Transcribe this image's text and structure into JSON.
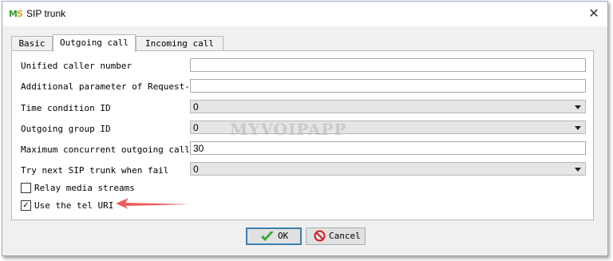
{
  "window": {
    "title": "SIP trunk",
    "close_glyph": "✕"
  },
  "tabs": [
    {
      "label": "Basic",
      "active": false
    },
    {
      "label": "Outgoing call",
      "active": true
    },
    {
      "label": "Incoming call",
      "active": false
    }
  ],
  "form": {
    "unified_caller_number": {
      "label": "Unified caller number",
      "value": ""
    },
    "additional_parameter": {
      "label": "Additional parameter of Request-URI",
      "value": ""
    },
    "time_condition_id": {
      "label": "Time condition ID",
      "value": "0"
    },
    "outgoing_group_id": {
      "label": "Outgoing group ID",
      "value": "0"
    },
    "max_concurrent_outgoing": {
      "label": "Maximum concurrent outgoing calls",
      "value": "30"
    },
    "try_next_trunk": {
      "label": "Try next SIP trunk when fail",
      "value": "0"
    },
    "relay_media_streams": {
      "label": "Relay media streams",
      "checked": false
    },
    "use_tel_uri": {
      "label": "Use the tel URI",
      "checked": true,
      "check_glyph": "✓"
    }
  },
  "watermark": "MYVOIPAPP",
  "buttons": {
    "ok": "OK",
    "cancel": "Cancel"
  },
  "colors": {
    "annotation_arrow": "#f05a5a",
    "ok_icon": "#3aa63a",
    "cancel_icon": "#d02020"
  },
  "icons": {
    "app": "app-logo-icon",
    "ok": "checkmark-icon",
    "cancel": "no-entry-icon"
  }
}
